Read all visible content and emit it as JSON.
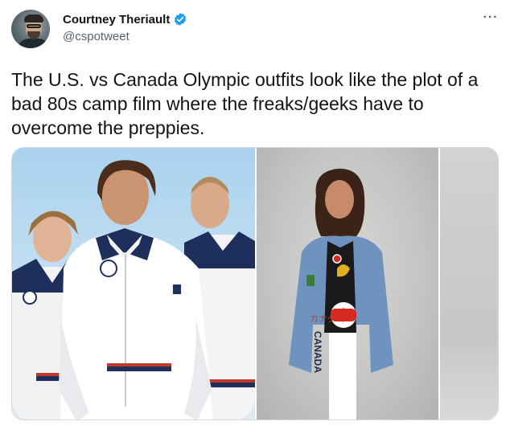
{
  "author": {
    "display_name": "Courtney Theriault",
    "handle": "@cspotweet",
    "verified": true
  },
  "tweet": {
    "text": "The U.S. vs Canada Olympic outfits look like the plot of a bad 80s camp film where the freaks/geeks have to overcome the preppies.",
    "more_menu": "···"
  },
  "media": {
    "photo_count": 3,
    "canada_jacket_text": "CANADA",
    "canada_jacket_katakana": "カナダ"
  },
  "colors": {
    "verified_blue": "#1d9bf0",
    "handle_gray": "#536471",
    "text_dark": "#0f1419",
    "usa_navy": "#1e2f5c",
    "canada_red": "#d52b1e",
    "denim": "#6f93bf"
  },
  "icons": {
    "verified": "verified-badge-icon",
    "more": "more-dots-icon"
  }
}
